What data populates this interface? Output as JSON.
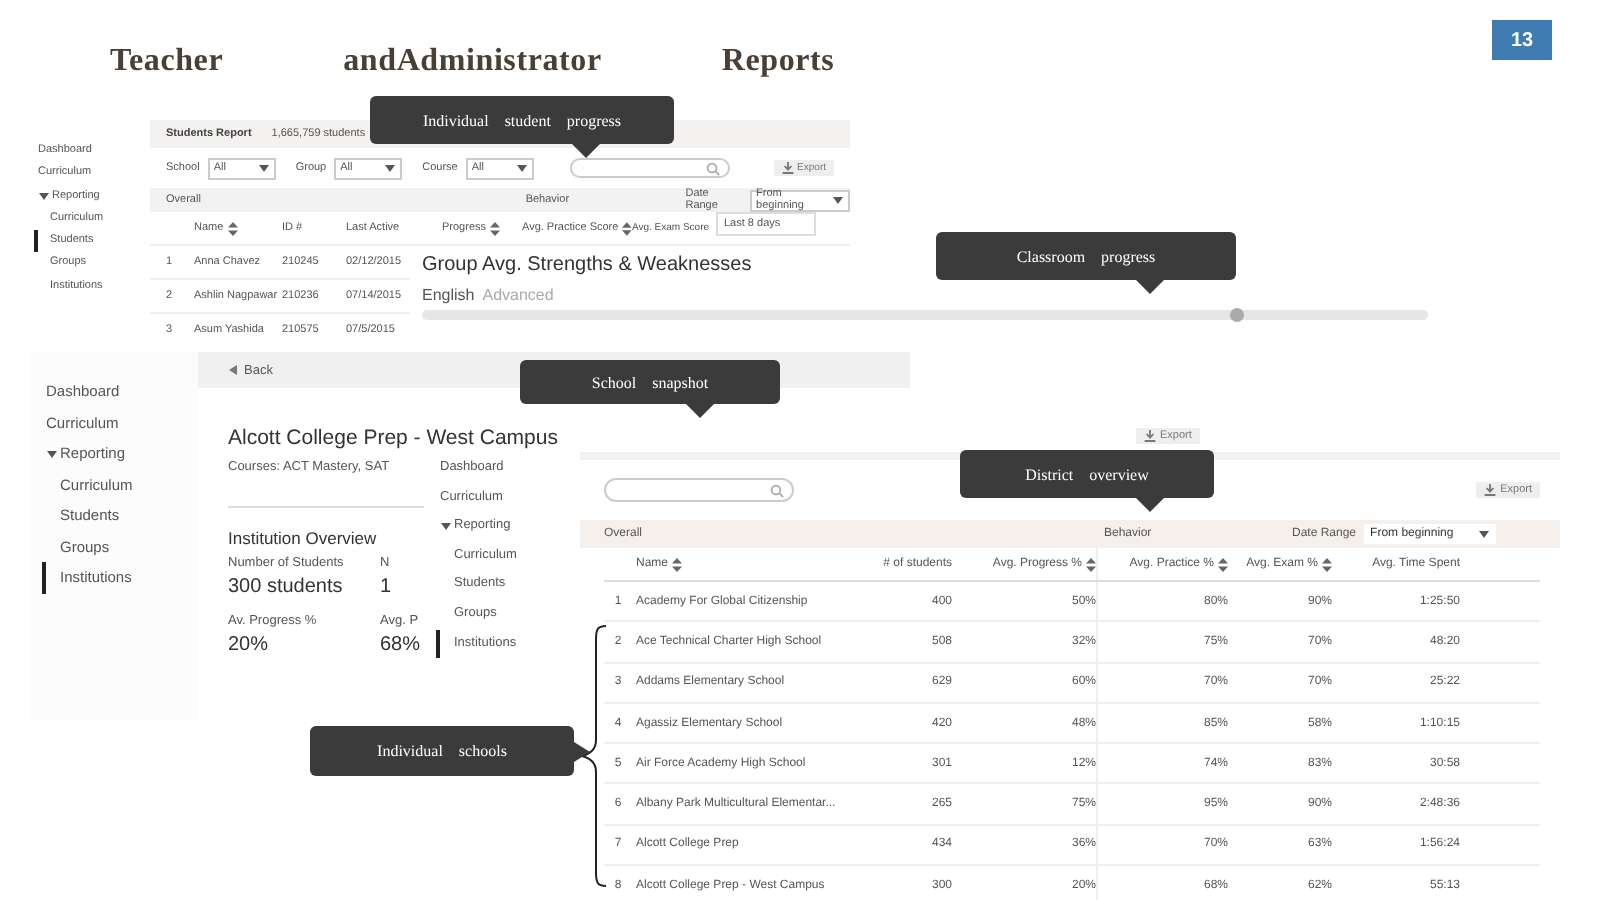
{
  "title": "Teacher andAdministrator Reports",
  "page_number": "13",
  "students_report": {
    "sidebar": [
      {
        "label": "Dashboard",
        "selected": false
      },
      {
        "label": "Curriculum",
        "selected": false
      },
      {
        "label": "Reporting",
        "expanded": true,
        "selected": false,
        "children": [
          {
            "label": "Curriculum",
            "selected": false
          },
          {
            "label": "Students",
            "selected": true
          },
          {
            "label": "Groups",
            "selected": false
          },
          {
            "label": "Institutions",
            "selected": false
          }
        ]
      }
    ],
    "heading": "Students Report",
    "count": "1,665,759 students",
    "filters": [
      {
        "label": "School",
        "value": "All"
      },
      {
        "label": "Group",
        "value": "All"
      },
      {
        "label": "Course",
        "value": "All"
      }
    ],
    "export": "Export",
    "band": {
      "overall": "Overall",
      "behavior": "Behavior",
      "date_range": "Date Range",
      "dropdown": {
        "value": "From beginning",
        "options": [
          "Last 8 days"
        ]
      }
    },
    "columns": [
      {
        "label": "Name",
        "sortable": true
      },
      {
        "label": "ID #",
        "sortable": false
      },
      {
        "label": "Last Active",
        "sortable": false
      },
      {
        "label": "Progress",
        "sortable": true
      },
      {
        "label": "Avg. Practice Score",
        "sortable": true
      },
      {
        "label": "Avg. Exam Score",
        "sortable": false
      }
    ],
    "rows": [
      {
        "number": "1",
        "cells": [
          "Anna Chavez",
          "210245",
          "02/12/2015"
        ]
      },
      {
        "number": "2",
        "cells": [
          "Ashlin Nagpawar",
          "210236",
          "07/14/2015"
        ]
      },
      {
        "number": "3",
        "cells": [
          "Asum Yashida",
          "210575",
          "07/5/2015"
        ]
      }
    ]
  },
  "group_strengths": {
    "title": "Group Avg. Strengths & Weaknesses",
    "subjects": [
      {
        "name": "English",
        "rating": "Advanced",
        "level": 0.81
      }
    ]
  },
  "school_snapshot": {
    "sidebar": [
      {
        "label": "Dashboard",
        "selected": false
      },
      {
        "label": "Curriculum",
        "selected": false
      },
      {
        "label": "Reporting",
        "expanded": true,
        "selected": false,
        "children": [
          {
            "label": "Curriculum",
            "selected": false
          },
          {
            "label": "Students",
            "selected": false
          },
          {
            "label": "Groups",
            "selected": false
          },
          {
            "label": "Institutions",
            "selected": true
          }
        ]
      }
    ],
    "back": "Back",
    "title": "Alcott College Prep - West Campus",
    "courses": "Courses: ACT Mastery, SAT",
    "export": "Export",
    "section": "Institution Overview",
    "stats": [
      {
        "label": "Number of Students",
        "value": "300 students"
      },
      {
        "label": "N",
        "value": "1"
      },
      {
        "label": "Av. Progress %",
        "value": "20%"
      },
      {
        "label": "Avg. P",
        "value": "68%"
      }
    ]
  },
  "district_overview": {
    "sidebar": [
      {
        "label": "Dashboard",
        "selected": false
      },
      {
        "label": "Curriculum",
        "selected": false
      },
      {
        "label": "Reporting",
        "expanded": true,
        "selected": false,
        "children": [
          {
            "label": "Curriculum",
            "selected": false
          },
          {
            "label": "Students",
            "selected": false
          },
          {
            "label": "Groups",
            "selected": false
          },
          {
            "label": "Institutions",
            "selected": true
          }
        ]
      }
    ],
    "export": "Export",
    "band": {
      "overall": "Overall",
      "behavior": "Behavior",
      "date_range": "Date Range",
      "dropdown": "From beginning"
    },
    "columns": [
      {
        "label": "Name",
        "sortable": true
      },
      {
        "label": "# of students",
        "sortable": false
      },
      {
        "label": "Avg. Progress %",
        "sortable": true
      },
      {
        "label": "Avg. Practice %",
        "sortable": true
      },
      {
        "label": "Avg. Exam %",
        "sortable": true
      },
      {
        "label": "Avg. Time Spent",
        "sortable": false
      }
    ],
    "rows": [
      {
        "number": "1",
        "cells": [
          "Academy For Global Citizenship",
          "400",
          "50%",
          "80%",
          "90%",
          "1:25:50"
        ]
      },
      {
        "number": "2",
        "cells": [
          "Ace Technical Charter High School",
          "508",
          "32%",
          "75%",
          "70%",
          "48:20"
        ]
      },
      {
        "number": "3",
        "cells": [
          "Addams Elementary School",
          "629",
          "60%",
          "70%",
          "70%",
          "25:22"
        ]
      },
      {
        "number": "4",
        "cells": [
          "Agassiz Elementary School",
          "420",
          "48%",
          "85%",
          "58%",
          "1:10:15"
        ]
      },
      {
        "number": "5",
        "cells": [
          "Air Force Academy High School",
          "301",
          "12%",
          "74%",
          "83%",
          "30:58"
        ]
      },
      {
        "number": "6",
        "cells": [
          "Albany Park Multicultural Elementar...",
          "265",
          "75%",
          "95%",
          "90%",
          "2:48:36"
        ]
      },
      {
        "number": "7",
        "cells": [
          "Alcott College Prep",
          "434",
          "36%",
          "70%",
          "63%",
          "1:56:24"
        ]
      },
      {
        "number": "8",
        "cells": [
          "Alcott College Prep - West Campus",
          "300",
          "20%",
          "68%",
          "62%",
          "55:13"
        ]
      }
    ]
  },
  "callouts": [
    {
      "text": "Individual student progress",
      "kind": "down"
    },
    {
      "text": "Classroom progress",
      "kind": "down"
    },
    {
      "text": "School snapshot",
      "kind": "down"
    },
    {
      "text": "District overview",
      "kind": "down"
    },
    {
      "text": "Individual schools",
      "kind": "right"
    }
  ]
}
